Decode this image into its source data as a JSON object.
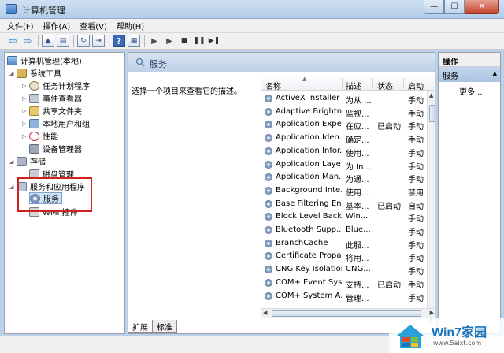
{
  "window": {
    "title": "计算机管理",
    "controls": {
      "minimize": "—",
      "maximize": "☐",
      "close": "✕"
    }
  },
  "menu": [
    "文件(F)",
    "操作(A)",
    "查看(V)",
    "帮助(H)"
  ],
  "toolbar": {
    "back": "⇦",
    "forward": "⇨",
    "help": "?",
    "play": "▶",
    "play2": "▶",
    "stop": "■",
    "pause": "❚❚",
    "restart": "▶❚"
  },
  "tree": {
    "root": "计算机管理(本地)",
    "system_tools": "系统工具",
    "task_scheduler": "任务计划程序",
    "event_viewer": "事件查看器",
    "shared_folders": "共享文件夹",
    "local_users": "本地用户和组",
    "performance": "性能",
    "device_manager": "设备管理器",
    "storage": "存储",
    "disk_management": "磁盘管理",
    "services_apps": "服务和应用程序",
    "services": "服务",
    "wmi": "WMI 控件"
  },
  "main": {
    "header": "服务",
    "description": "选择一个项目来查看它的描述。",
    "columns": {
      "name": "名称",
      "desc": "描述",
      "status": "状态",
      "startup": "启动"
    },
    "rows": [
      {
        "name": "ActiveX Installer ...",
        "desc": "为从 ...",
        "status": "",
        "startup": "手动"
      },
      {
        "name": "Adaptive Brightn...",
        "desc": "监视...",
        "status": "",
        "startup": "手动"
      },
      {
        "name": "Application Expe...",
        "desc": "在应...",
        "status": "已启动",
        "startup": "手动"
      },
      {
        "name": "Application Iden...",
        "desc": "确定...",
        "status": "",
        "startup": "手动"
      },
      {
        "name": "Application Infor...",
        "desc": "使用...",
        "status": "",
        "startup": "手动"
      },
      {
        "name": "Application Laye...",
        "desc": "为 In...",
        "status": "",
        "startup": "手动"
      },
      {
        "name": "Application Man...",
        "desc": "为通...",
        "status": "",
        "startup": "手动"
      },
      {
        "name": "Background Inte...",
        "desc": "使用...",
        "status": "",
        "startup": "禁用"
      },
      {
        "name": "Base Filtering En...",
        "desc": "基本...",
        "status": "已启动",
        "startup": "自动"
      },
      {
        "name": "Block Level Back...",
        "desc": "Win...",
        "status": "",
        "startup": "手动"
      },
      {
        "name": "Bluetooth Supp...",
        "desc": "Blue...",
        "status": "",
        "startup": "手动"
      },
      {
        "name": "BranchCache",
        "desc": "此服...",
        "status": "",
        "startup": "手动"
      },
      {
        "name": "Certificate Propa...",
        "desc": "将用...",
        "status": "",
        "startup": "手动"
      },
      {
        "name": "CNG Key Isolation",
        "desc": "CNG...",
        "status": "",
        "startup": "手动"
      },
      {
        "name": "COM+ Event Sys...",
        "desc": "支持...",
        "status": "已启动",
        "startup": "手动"
      },
      {
        "name": "COM+ System A...",
        "desc": "管理...",
        "status": "",
        "startup": "手动"
      }
    ]
  },
  "tabs": [
    "扩展",
    "标准"
  ],
  "actions": {
    "header": "操作",
    "section": "服务",
    "more": "更多..."
  },
  "watermark": {
    "brand": "Win7家园",
    "url": "www.5aixt.com"
  },
  "colors": {
    "highlight_box": "#d12020",
    "selection": "#cde3f8",
    "watermark_blue": "#1c73b9"
  }
}
